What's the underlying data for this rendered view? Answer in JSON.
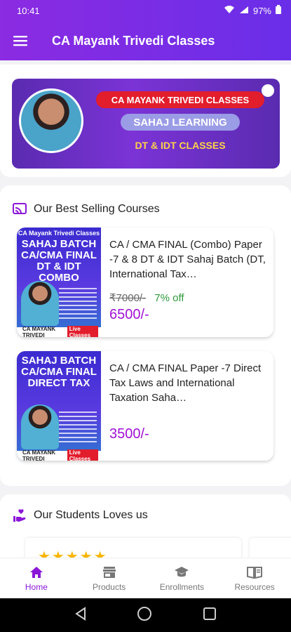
{
  "status": {
    "time": "10:41",
    "battery": "97%"
  },
  "app_bar": {
    "title": "CA Mayank Trivedi Classes"
  },
  "banner": {
    "line1": "CA MAYANK TRIVEDI CLASSES",
    "line2": "SAHAJ LEARNING",
    "line3": "DT & IDT CLASSES"
  },
  "best_selling": {
    "heading": "Our Best Selling Courses",
    "courses": [
      {
        "thumb_top": "CA Mayank Trivedi Classes",
        "thumb_title": "SAHAJ BATCH CA/CMA FINAL DT & IDT COMBO",
        "thumb_foot": "CA MAYANK TRIVEDI",
        "thumb_live": "Live Classes",
        "title": "CA / CMA FINAL (Combo) Paper -7 & 8 DT & IDT Sahaj Batch (DT, International Tax…",
        "old_price": "₹7000/-",
        "discount": "7% off",
        "price": "6500/-"
      },
      {
        "thumb_top": "",
        "thumb_title": "SAHAJ BATCH CA/CMA FINAL DIRECT TAX",
        "thumb_foot": "CA MAYANK TRIVEDI",
        "thumb_live": "Live Classes",
        "title": "CA / CMA FINAL Paper -7 Direct Tax Laws and International Taxation Saha…",
        "old_price": "",
        "discount": "",
        "price": "3500/-"
      }
    ]
  },
  "students": {
    "heading": "Our Students Loves us",
    "stars": "★★★★★"
  },
  "bottom_nav": [
    {
      "label": "Home",
      "icon": "home-icon"
    },
    {
      "label": "Products",
      "icon": "store-icon"
    },
    {
      "label": "Enrollments",
      "icon": "graduation-cap-icon"
    },
    {
      "label": "Resources",
      "icon": "book-icon"
    }
  ],
  "colors": {
    "primary": "#8b2be2",
    "accent_price": "#a20fd6",
    "discount": "#2e9b3c",
    "star": "#f7b500"
  }
}
